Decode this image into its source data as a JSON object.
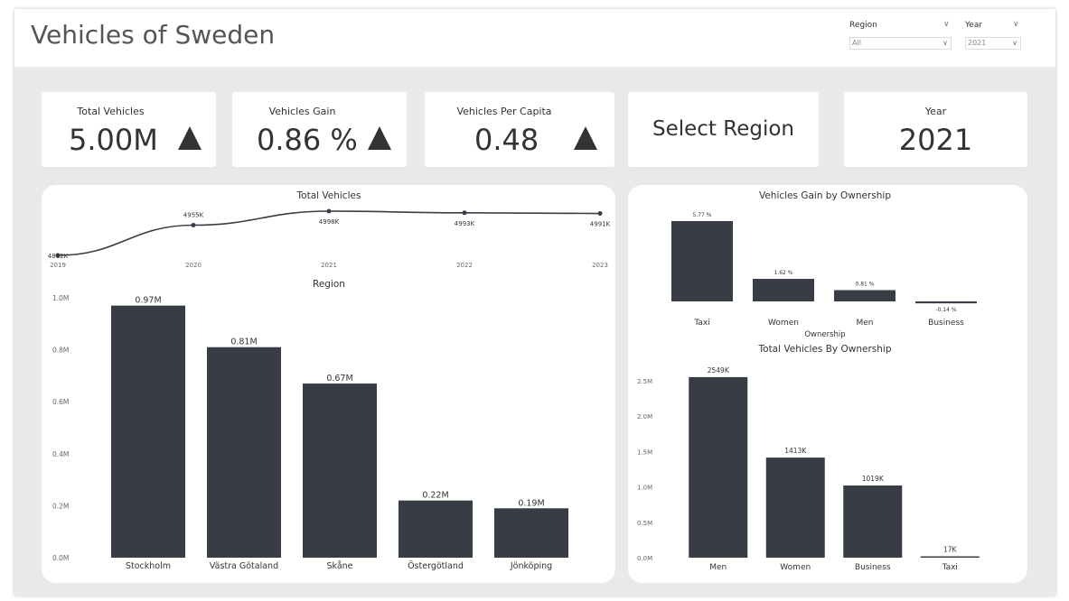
{
  "header": {
    "title": "Vehicles of Sweden"
  },
  "slicers": {
    "region": {
      "label": "Region",
      "value": "All"
    },
    "year": {
      "label": "Year",
      "value": "2021"
    }
  },
  "cards": {
    "total_vehicles": {
      "title": "Total Vehicles",
      "value": "5.00M",
      "indicator": "up-triangle-icon"
    },
    "vehicles_gain": {
      "title": "Vehicles Gain",
      "value": "0.86 %",
      "indicator": "up-triangle-icon"
    },
    "vehicles_per_capita": {
      "title": "Vehicles Per Capita",
      "value": "0.48",
      "indicator": "up-triangle-icon"
    },
    "select_region": {
      "value": "Select Region"
    },
    "year": {
      "title": "Year",
      "value": "2021"
    }
  },
  "colors": {
    "bar": "#383c44",
    "line": "#383c44",
    "background": "#e9e9e9",
    "card": "#ffffff"
  },
  "chart_data": [
    {
      "id": "total_vehicles_line",
      "type": "line",
      "title": "Total Vehicles",
      "x": [
        "2019",
        "2020",
        "2021",
        "2022",
        "2023"
      ],
      "values": [
        4862,
        4955,
        4998,
        4993,
        4991
      ],
      "labels": [
        "4862K",
        "4955K",
        "4998K",
        "4993K",
        "4991K"
      ]
    },
    {
      "id": "region_bar",
      "type": "bar",
      "title": "Region",
      "categories": [
        "Stockholm",
        "Västra Götaland",
        "Skåne",
        "Östergötland",
        "Jönköping"
      ],
      "values": [
        0.97,
        0.81,
        0.67,
        0.22,
        0.19
      ],
      "labels": [
        "0.97M",
        "0.81M",
        "0.67M",
        "0.22M",
        "0.19M"
      ],
      "yticks": [
        "0.0M",
        "0.2M",
        "0.4M",
        "0.6M",
        "0.8M",
        "1.0M"
      ],
      "ylim": [
        0,
        1.0
      ]
    },
    {
      "id": "gain_by_ownership",
      "type": "bar",
      "title": "Vehicles Gain by Ownership",
      "xlabel": "Ownership",
      "categories": [
        "Taxi",
        "Women",
        "Men",
        "Business"
      ],
      "values": [
        5.77,
        1.62,
        0.81,
        -0.14
      ],
      "labels": [
        "5.77 %",
        "1.62 %",
        "0.81 %",
        "-0.14 %"
      ]
    },
    {
      "id": "total_by_ownership",
      "type": "bar",
      "title": "Total Vehicles By Ownership",
      "categories": [
        "Men",
        "Women",
        "Business",
        "Taxi"
      ],
      "values": [
        2549,
        1413,
        1019,
        17
      ],
      "labels": [
        "2549K",
        "1413K",
        "1019K",
        "17K"
      ],
      "yticks": [
        "0.0M",
        "0.5M",
        "1.0M",
        "1.5M",
        "2.0M",
        "2.5M"
      ],
      "ylim": [
        0,
        2750
      ]
    }
  ]
}
